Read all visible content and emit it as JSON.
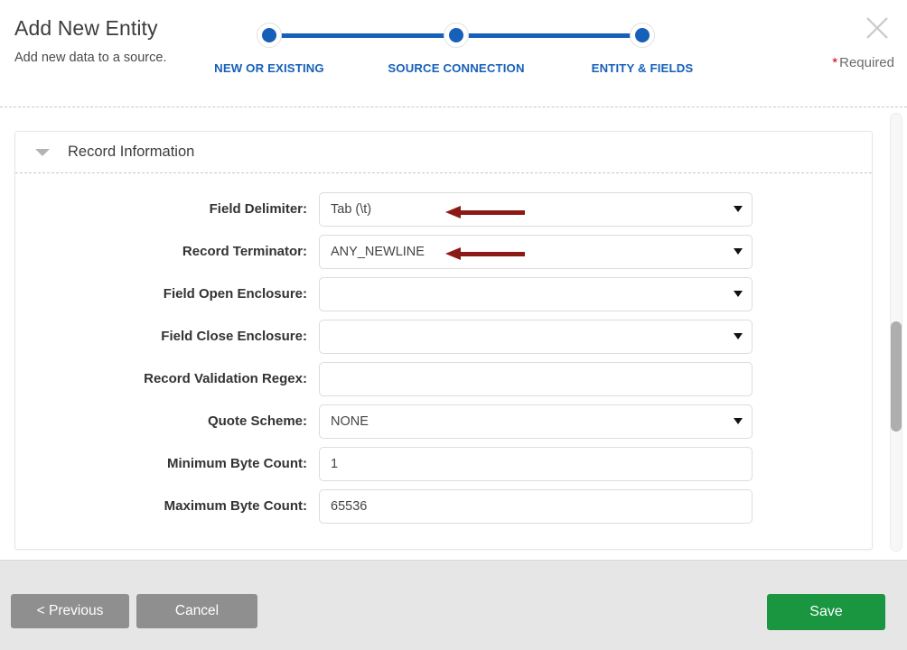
{
  "header": {
    "title": "Add New Entity",
    "subtitle": "Add new data to a source.",
    "close_icon": "close-icon",
    "required_star": "*",
    "required_label": "Required"
  },
  "stepper": {
    "steps": [
      {
        "label": "NEW OR EXISTING",
        "state": "complete"
      },
      {
        "label": "SOURCE CONNECTION",
        "state": "complete"
      },
      {
        "label": "ENTITY & FIELDS",
        "state": "current"
      }
    ],
    "accent_color": "#1660b8"
  },
  "panel": {
    "title": "Record Information",
    "collapse_icon": "chevron-down-icon",
    "expanded": true
  },
  "form": {
    "fields": [
      {
        "label": "Field Delimiter:",
        "name": "field-delimiter",
        "type": "select",
        "value": "Tab (\\t)",
        "placeholder": "",
        "annotated": true
      },
      {
        "label": "Record Terminator:",
        "name": "record-terminator",
        "type": "select",
        "value": "ANY_NEWLINE",
        "placeholder": "",
        "annotated": true
      },
      {
        "label": "Field Open Enclosure:",
        "name": "field-open-enclosure",
        "type": "select",
        "value": "",
        "placeholder": "",
        "annotated": false
      },
      {
        "label": "Field Close Enclosure:",
        "name": "field-close-enclosure",
        "type": "select",
        "value": "",
        "placeholder": "",
        "annotated": false
      },
      {
        "label": "Record Validation Regex:",
        "name": "record-validation-regex",
        "type": "text",
        "value": "",
        "placeholder": "",
        "annotated": false
      },
      {
        "label": "Quote Scheme:",
        "name": "quote-scheme",
        "type": "select",
        "value": "NONE",
        "placeholder": "",
        "annotated": false
      },
      {
        "label": "Minimum Byte Count:",
        "name": "minimum-byte-count",
        "type": "text",
        "value": "1",
        "placeholder": "",
        "annotated": false
      },
      {
        "label": "Maximum Byte Count:",
        "name": "maximum-byte-count",
        "type": "text",
        "value": "65536",
        "placeholder": "",
        "annotated": false
      }
    ]
  },
  "annotations": {
    "color": "#8b1a16",
    "arrows": [
      {
        "points_to": "field-delimiter",
        "direction": "left"
      },
      {
        "points_to": "record-terminator",
        "direction": "left"
      }
    ]
  },
  "footer": {
    "previous_label": "< Previous",
    "cancel_label": "Cancel",
    "save_label": "Save",
    "save_color": "#1a9641",
    "secondary_color": "#8f8f8f"
  },
  "scrollbar": {
    "orientation": "vertical",
    "thumb_position_percent": 47
  }
}
